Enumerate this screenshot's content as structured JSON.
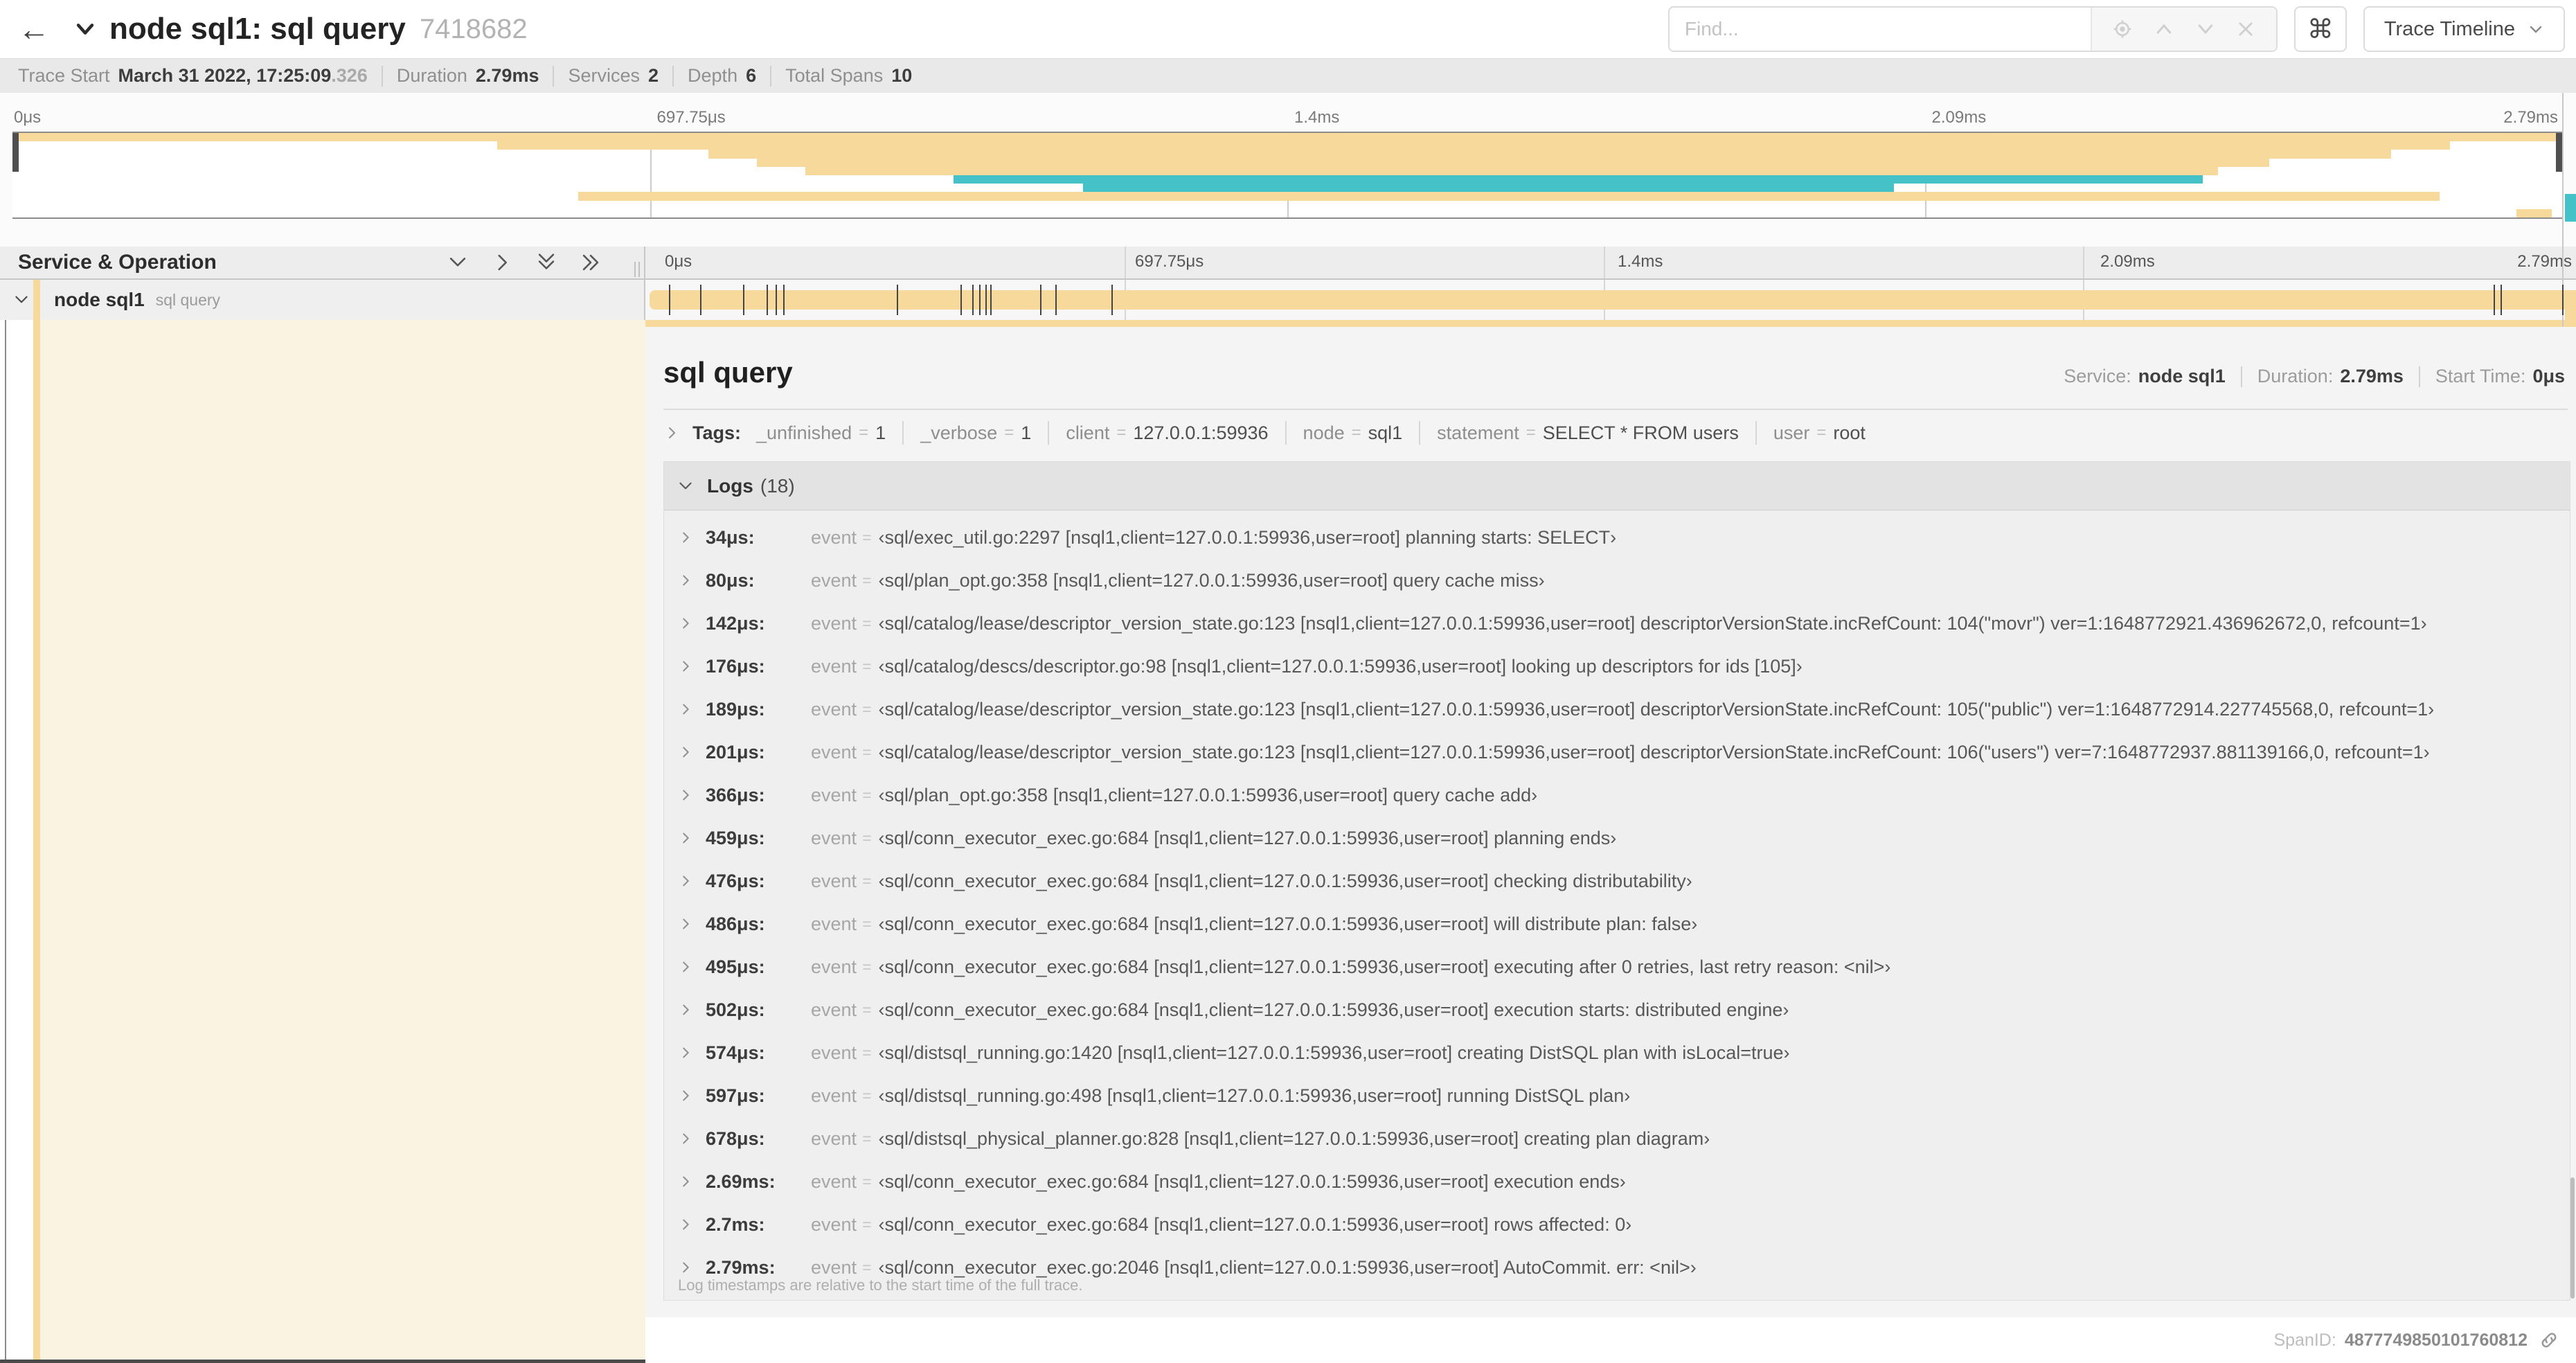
{
  "colors": {
    "span_tan": "#F6D99B",
    "span_teal": "#45C2C8",
    "detail_cream": "#FAF3E2"
  },
  "header": {
    "back_icon": "←",
    "title": "node sql1: sql query",
    "trace_id": "7418682",
    "find_placeholder": "Find...",
    "shortcut_key": "⌘",
    "view_selector": "Trace Timeline"
  },
  "summary": {
    "items": [
      {
        "label": "Trace Start",
        "value": "March 31 2022, 17:25:09",
        "suffix": ".326"
      },
      {
        "label": "Duration",
        "value": "2.79ms",
        "suffix": ""
      },
      {
        "label": "Services",
        "value": "2",
        "suffix": ""
      },
      {
        "label": "Depth",
        "value": "6",
        "suffix": ""
      },
      {
        "label": "Total Spans",
        "value": "10",
        "suffix": ""
      }
    ]
  },
  "ruler": {
    "labels": [
      {
        "pct": 0,
        "text": "0μs"
      },
      {
        "pct": 25,
        "text": "697.75μs"
      },
      {
        "pct": 50,
        "text": "1.4ms"
      },
      {
        "pct": 75,
        "text": "2.09ms"
      },
      {
        "pct": 100,
        "text": "2.79ms"
      }
    ],
    "gridlines": [
      25,
      50,
      75
    ]
  },
  "minimap": {
    "bars": [
      {
        "row": 1,
        "start": 0,
        "end": 100,
        "color": "tan"
      },
      {
        "row": 2,
        "start": 19,
        "end": 95.6,
        "color": "tan"
      },
      {
        "row": 3,
        "start": 27.3,
        "end": 93.3,
        "color": "tan"
      },
      {
        "row": 4,
        "start": 29.2,
        "end": 88.5,
        "color": "tan"
      },
      {
        "row": 5,
        "start": 31.1,
        "end": 86.5,
        "color": "tan"
      },
      {
        "row": 6,
        "start": 36.9,
        "end": 85.9,
        "color": "teal"
      },
      {
        "row": 7,
        "start": 42,
        "end": 73.8,
        "color": "teal"
      },
      {
        "row": 8,
        "start": 22.2,
        "end": 95.2,
        "color": "tan"
      },
      {
        "row": 10,
        "start": 98.2,
        "end": 99.6,
        "color": "tan"
      }
    ]
  },
  "service_operation": {
    "header": "Service & Operation",
    "service": "node sql1",
    "operation": "sql query",
    "trace_duration_us": 2790
  },
  "detail": {
    "title": "sql query",
    "overview": [
      {
        "label": "Service:",
        "value": "node sql1"
      },
      {
        "label": "Duration:",
        "value": "2.79ms"
      },
      {
        "label": "Start Time:",
        "value": "0μs"
      }
    ],
    "tags_label": "Tags:",
    "tags": [
      {
        "key": "_unfinished",
        "value": "1"
      },
      {
        "key": "_verbose",
        "value": "1"
      },
      {
        "key": "client",
        "value": "127.0.0.1:59936"
      },
      {
        "key": "node",
        "value": "sql1"
      },
      {
        "key": "statement",
        "value": "SELECT * FROM users"
      },
      {
        "key": "user",
        "value": "root"
      }
    ],
    "logs_label": "Logs",
    "logs_count": "(18)",
    "log_key": "event",
    "logs": [
      {
        "t": "34μs:",
        "t_us": 34,
        "value": "‹sql/exec_util.go:2297 [nsql1,client=127.0.0.1:59936,user=root] planning starts: SELECT›"
      },
      {
        "t": "80μs:",
        "t_us": 80,
        "value": "‹sql/plan_opt.go:358 [nsql1,client=127.0.0.1:59936,user=root] query cache miss›"
      },
      {
        "t": "142μs:",
        "t_us": 142,
        "value": "‹sql/catalog/lease/descriptor_version_state.go:123 [nsql1,client=127.0.0.1:59936,user=root] descriptorVersionState.incRefCount: 104(\"movr\") ver=1:1648772921.436962672,0, refcount=1›"
      },
      {
        "t": "176μs:",
        "t_us": 176,
        "value": "‹sql/catalog/descs/descriptor.go:98 [nsql1,client=127.0.0.1:59936,user=root] looking up descriptors for ids [105]›"
      },
      {
        "t": "189μs:",
        "t_us": 189,
        "value": "‹sql/catalog/lease/descriptor_version_state.go:123 [nsql1,client=127.0.0.1:59936,user=root] descriptorVersionState.incRefCount: 105(\"public\") ver=1:1648772914.227745568,0, refcount=1›"
      },
      {
        "t": "201μs:",
        "t_us": 201,
        "value": "‹sql/catalog/lease/descriptor_version_state.go:123 [nsql1,client=127.0.0.1:59936,user=root] descriptorVersionState.incRefCount: 106(\"users\") ver=7:1648772937.881139166,0, refcount=1›"
      },
      {
        "t": "366μs:",
        "t_us": 366,
        "value": "‹sql/plan_opt.go:358 [nsql1,client=127.0.0.1:59936,user=root] query cache add›"
      },
      {
        "t": "459μs:",
        "t_us": 459,
        "value": "‹sql/conn_executor_exec.go:684 [nsql1,client=127.0.0.1:59936,user=root] planning ends›"
      },
      {
        "t": "476μs:",
        "t_us": 476,
        "value": "‹sql/conn_executor_exec.go:684 [nsql1,client=127.0.0.1:59936,user=root] checking distributability›"
      },
      {
        "t": "486μs:",
        "t_us": 486,
        "value": "‹sql/conn_executor_exec.go:684 [nsql1,client=127.0.0.1:59936,user=root] will distribute plan: false›"
      },
      {
        "t": "495μs:",
        "t_us": 495,
        "value": "‹sql/conn_executor_exec.go:684 [nsql1,client=127.0.0.1:59936,user=root] executing after 0 retries, last retry reason: <nil>›"
      },
      {
        "t": "502μs:",
        "t_us": 502,
        "value": "‹sql/conn_executor_exec.go:684 [nsql1,client=127.0.0.1:59936,user=root] execution starts: distributed engine›"
      },
      {
        "t": "574μs:",
        "t_us": 574,
        "value": "‹sql/distsql_running.go:1420 [nsql1,client=127.0.0.1:59936,user=root] creating DistSQL plan with isLocal=true›"
      },
      {
        "t": "597μs:",
        "t_us": 597,
        "value": "‹sql/distsql_running.go:498 [nsql1,client=127.0.0.1:59936,user=root] running DistSQL plan›"
      },
      {
        "t": "678μs:",
        "t_us": 678,
        "value": "‹sql/distsql_physical_planner.go:828 [nsql1,client=127.0.0.1:59936,user=root] creating plan diagram›"
      },
      {
        "t": "2.69ms:",
        "t_us": 2690,
        "value": "‹sql/conn_executor_exec.go:684 [nsql1,client=127.0.0.1:59936,user=root] execution ends›"
      },
      {
        "t": "2.7ms:",
        "t_us": 2700,
        "value": "‹sql/conn_executor_exec.go:684 [nsql1,client=127.0.0.1:59936,user=root] rows affected: 0›"
      },
      {
        "t": "2.79ms:",
        "t_us": 2790,
        "value": "‹sql/conn_executor_exec.go:2046 [nsql1,client=127.0.0.1:59936,user=root] AutoCommit. err: <nil>›"
      }
    ],
    "footer_note": "Log timestamps are relative to the start time of the full trace.",
    "span_id_label": "SpanID:",
    "span_id": "4877749850101760812"
  }
}
